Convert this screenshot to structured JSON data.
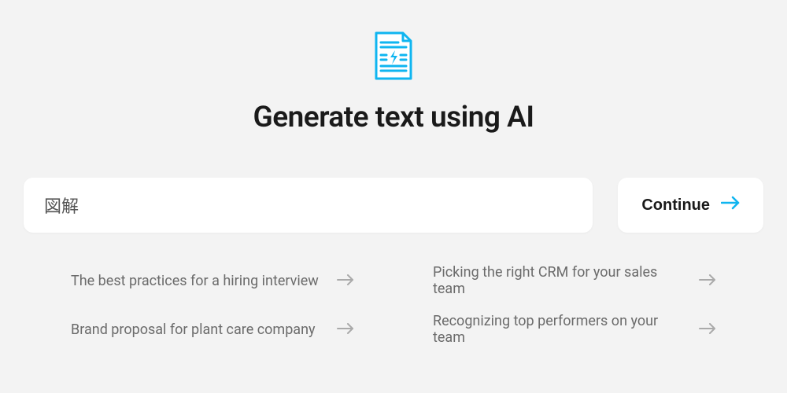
{
  "header": {
    "title": "Generate text using AI"
  },
  "prompt": {
    "value": "図解"
  },
  "actions": {
    "continue_label": "Continue"
  },
  "suggestions": [
    {
      "label": "The best practices for a hiring interview"
    },
    {
      "label": "Picking the right CRM for your sales team"
    },
    {
      "label": "Brand proposal for plant care company"
    },
    {
      "label": "Recognizing top performers on your team"
    }
  ],
  "colors": {
    "accent": "#0fb5f0"
  }
}
